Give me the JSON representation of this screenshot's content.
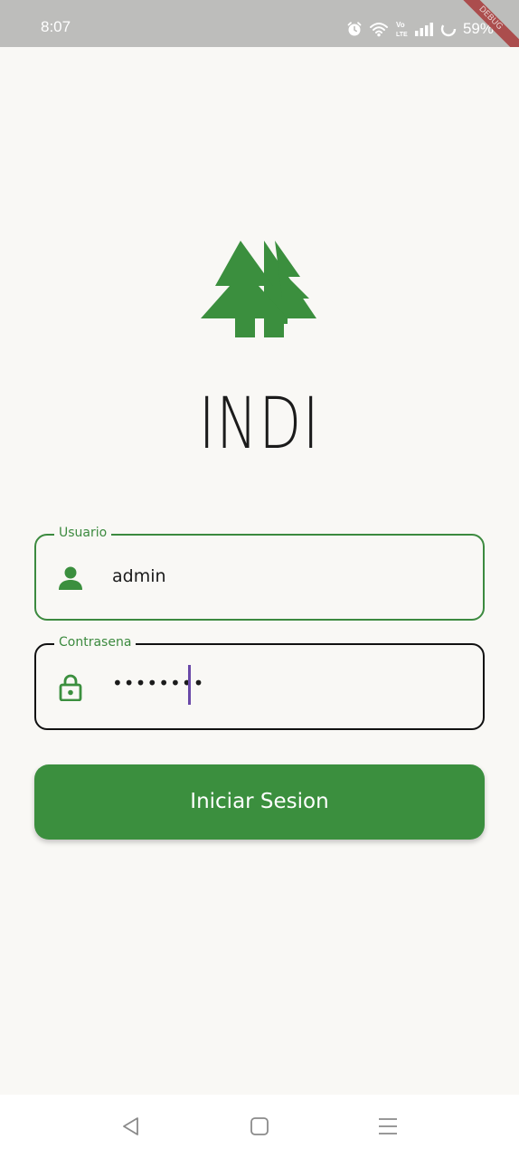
{
  "status_bar": {
    "time": "8:07",
    "battery_percent": "59%",
    "debug_ribbon": "DEBUG",
    "icons": [
      "alarm-icon",
      "wifi-icon",
      "volte-icon",
      "signal-icon",
      "battery-icon"
    ]
  },
  "app": {
    "title": "INDI",
    "logo": "pine-trees-logo"
  },
  "form": {
    "username": {
      "label": "Usuario",
      "value": "admin",
      "icon": "person-icon"
    },
    "password": {
      "label": "Contrasena",
      "value": "••••••••",
      "icon": "lock-icon"
    },
    "submit_label": "Iniciar Sesion"
  },
  "nav_bar": {
    "buttons": [
      "back-icon",
      "home-icon",
      "menu-icon"
    ]
  },
  "colors": {
    "accent": "#3b8f3e",
    "background": "#f9f8f5",
    "status_bar": "#bdbdbb",
    "caret": "#6a49a8"
  }
}
